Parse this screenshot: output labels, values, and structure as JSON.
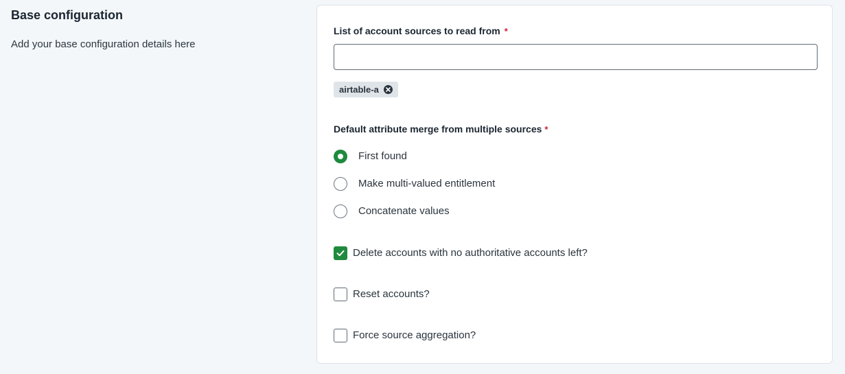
{
  "section": {
    "title": "Base configuration",
    "description": "Add your base configuration details here"
  },
  "sources_field": {
    "label": "List of account sources to read from",
    "required_mark": "*",
    "value": "",
    "chips": [
      {
        "label": "airtable-a"
      }
    ]
  },
  "merge_field": {
    "label": "Default attribute merge from multiple sources",
    "required_mark": "*",
    "options": [
      {
        "label": "First found",
        "selected": true
      },
      {
        "label": "Make multi-valued entitlement",
        "selected": false
      },
      {
        "label": "Concatenate values",
        "selected": false
      }
    ]
  },
  "checkboxes": [
    {
      "label": "Delete accounts with no authoritative accounts left?",
      "checked": true
    },
    {
      "label": "Reset accounts?",
      "checked": false
    },
    {
      "label": "Force source aggregation?",
      "checked": false
    }
  ],
  "colors": {
    "accent": "#1e8a3e",
    "required": "#d0213b",
    "background": "#f4f7fa"
  }
}
